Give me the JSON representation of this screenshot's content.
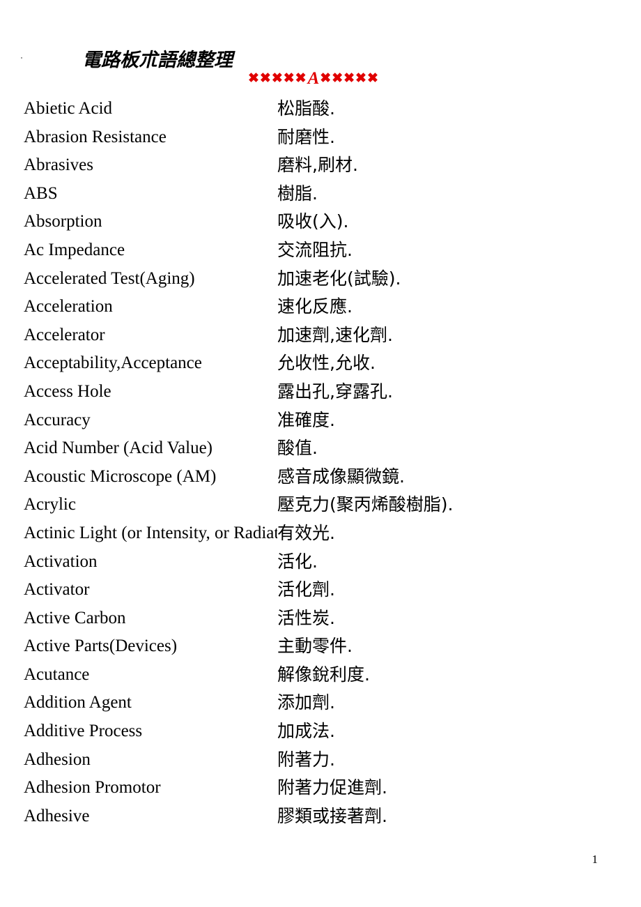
{
  "document": {
    "title": "電路板朮語總整理",
    "section_marker": {
      "stars_left": "✖✖✖✖✖",
      "letter": "A",
      "stars_right": "✖✖✖✖✖",
      "color": "#e00000"
    },
    "page_number": "1"
  },
  "glossary": {
    "entries": [
      {
        "term": "Abietic Acid",
        "definition": "松脂酸."
      },
      {
        "term": "Abrasion Resistance",
        "definition": "耐磨性."
      },
      {
        "term": "Abrasives",
        "definition": "磨料,刷材."
      },
      {
        "term": "ABS",
        "definition": "樹脂."
      },
      {
        "term": "Absorption",
        "definition": "吸收(入)."
      },
      {
        "term": "Ac Impedance",
        "definition": "交流阻抗."
      },
      {
        "term": "Accelerated Test(Aging)",
        "definition": "加速老化(試驗)."
      },
      {
        "term": "Acceleration",
        "definition": "速化反應."
      },
      {
        "term": "Accelerator",
        "definition": "加速劑,速化劑."
      },
      {
        "term": "Acceptability,Acceptance",
        "definition": "允收性,允收."
      },
      {
        "term": "Access Hole",
        "definition": "露出孔,穿露孔."
      },
      {
        "term": "Accuracy",
        "definition": "准確度."
      },
      {
        "term": "Acid Number (Acid Value)",
        "definition": "酸值."
      },
      {
        "term": "Acoustic Microscope (AM)",
        "definition": "感音成像顯微鏡."
      },
      {
        "term": "Acrylic",
        "definition": "壓克力(聚丙烯酸樹脂)."
      },
      {
        "term": "Actinic Light (or Intensity, or Radiation)",
        "definition": "有效光."
      },
      {
        "term": "Activation",
        "definition": "活化."
      },
      {
        "term": "Activator",
        "definition": "活化劑."
      },
      {
        "term": "Active Carbon",
        "definition": "活性炭."
      },
      {
        "term": "Active Parts(Devices)",
        "definition": "主動零件."
      },
      {
        "term": "Acutance",
        "definition": "解像銳利度."
      },
      {
        "term": "Addition Agent",
        "definition": "添加劑."
      },
      {
        "term": "Additive Process",
        "definition": "加成法."
      },
      {
        "term": "Adhesion",
        "definition": "附著力."
      },
      {
        "term": "Adhesion Promotor",
        "definition": "附著力促進劑."
      },
      {
        "term": "Adhesive",
        "definition": "膠類或接著劑."
      }
    ]
  }
}
